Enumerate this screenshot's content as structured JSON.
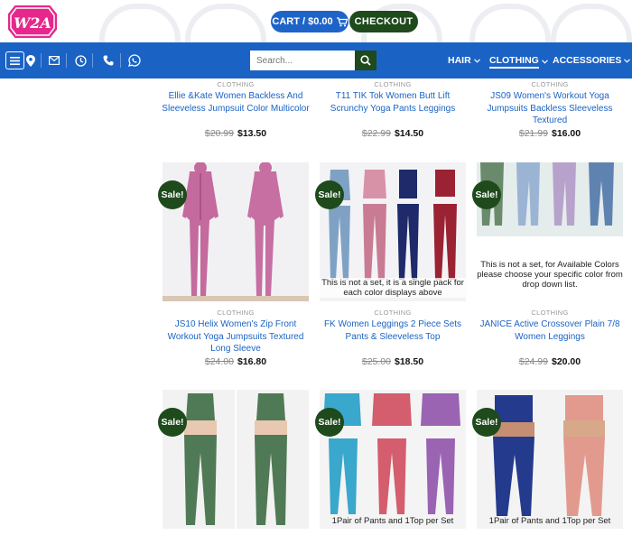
{
  "header": {
    "logo_text": "W2A",
    "cart_label": "CART / $0.00",
    "checkout_label": "CHECKOUT"
  },
  "nav": {
    "search_placeholder": "Search...",
    "links": [
      {
        "label": "HAIR"
      },
      {
        "label": "CLOTHING"
      },
      {
        "label": "ACCESSORIES"
      }
    ]
  },
  "products_top": [
    {
      "category": "CLOTHING",
      "name": "Ellie &Kate Women Backless And Sleeveless Jumpsuit Color Multicolor",
      "old_price": "$20.99",
      "price": "$13.50"
    },
    {
      "category": "CLOTHING",
      "name": "T11 TIK Tok Women Butt Lift Scrunchy Yoga Pants Leggings",
      "old_price": "$22.99",
      "price": "$14.50"
    },
    {
      "category": "CLOTHING",
      "name": "JS09 Women's Workout Yoga Jumpsuits Backless Sleeveless Textured",
      "old_price": "$21.99",
      "price": "$16.00"
    }
  ],
  "products_mid": [
    {
      "badge": "Sale!",
      "category": "CLOTHING",
      "name": "JS10 Helix Women's Zip Front Workout Yoga Jumpsuits Textured Long Sleeve",
      "old_price": "$24.00",
      "price": "$16.80",
      "caption": ""
    },
    {
      "badge": "Sale!",
      "category": "CLOTHING",
      "name": "FK Women Leggings 2 Piece Sets Pants & Sleeveless Top",
      "old_price": "$25.00",
      "price": "$18.50",
      "caption": "This is not a set, it is a single pack for each color displays above"
    },
    {
      "badge": "Sale!",
      "category": "CLOTHING",
      "name": "JANICE Active Crossover Plain 7/8 Women Leggings",
      "old_price": "$24.99",
      "price": "$20.00",
      "caption": "This is not a set, for Available Colors please choose your specific color from drop down list."
    }
  ],
  "products_bottom": [
    {
      "badge": "Sale!",
      "caption": ""
    },
    {
      "badge": "Sale!",
      "caption": "1Pair of Pants and 1Top per Set"
    },
    {
      "badge": "Sale!",
      "caption": "1Pair of Pants and 1Top per Set"
    }
  ],
  "colors": {
    "brand_blue": "#1a63c4",
    "dark_green": "#1e4a1c",
    "logo_pink": "#e6288c"
  }
}
